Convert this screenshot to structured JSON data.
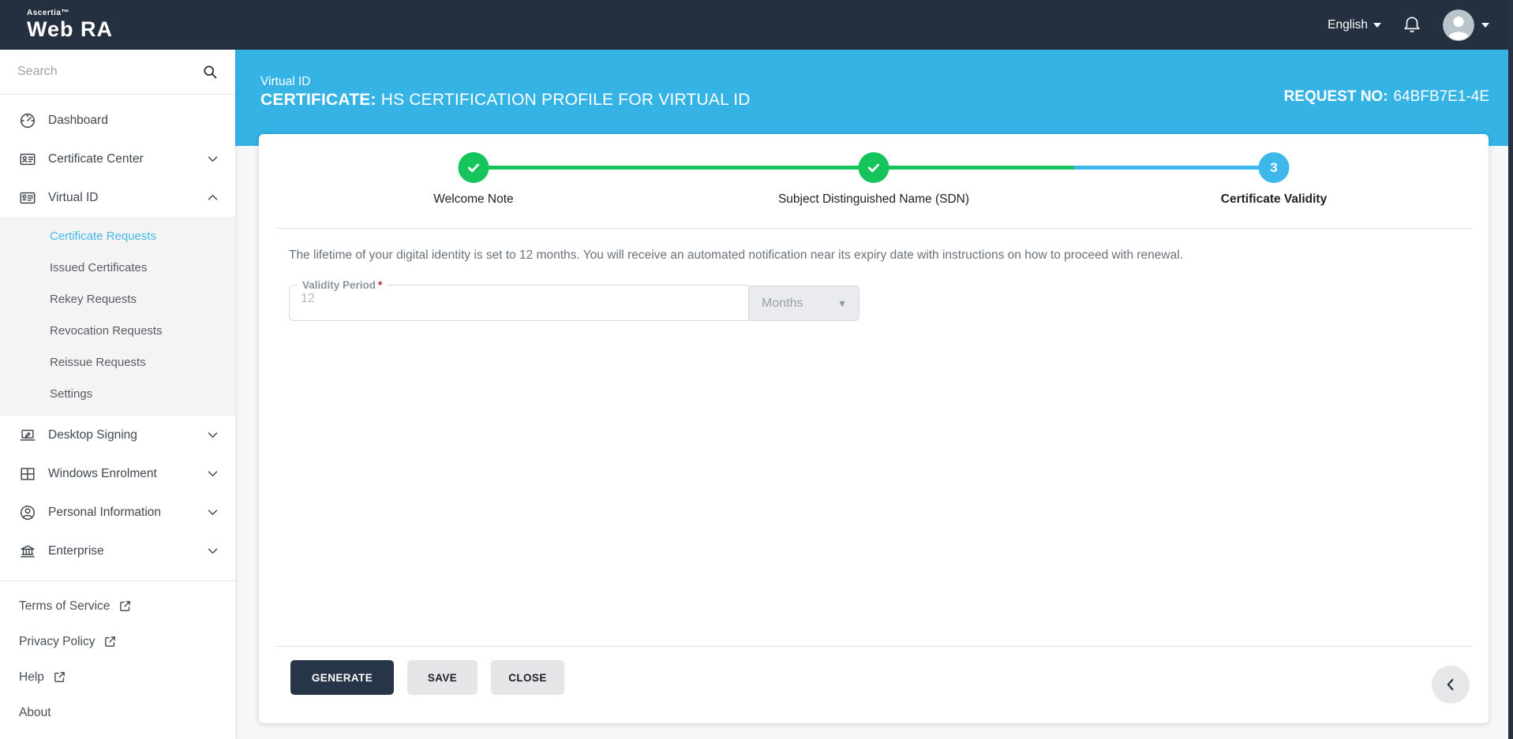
{
  "topbar": {
    "brand": {
      "company": "Ascertia™",
      "product_a": "Web",
      "product_b": "RA"
    },
    "language_label": "English"
  },
  "sidebar": {
    "search": {
      "placeholder": "Search"
    },
    "nav_upper": [
      {
        "label": "Dashboard"
      },
      {
        "label": "Certificate Center"
      },
      {
        "label": "Virtual ID"
      }
    ],
    "virtual_id_submenu": {
      "active": "Certificate Requests",
      "items": [
        "Certificate Requests",
        "Issued Certificates",
        "Rekey Requests",
        "Revocation Requests",
        "Reissue Requests",
        "Settings"
      ]
    },
    "nav_lower": [
      {
        "label": "Desktop Signing"
      },
      {
        "label": "Windows Enrolment"
      },
      {
        "label": "Personal Information"
      },
      {
        "label": "Enterprise"
      }
    ],
    "footer_links": [
      {
        "label": "Terms of Service",
        "external": true
      },
      {
        "label": "Privacy Policy",
        "external": true
      },
      {
        "label": "Help",
        "external": true
      },
      {
        "label": "About",
        "external": false
      }
    ]
  },
  "page_header": {
    "breadcrumb": "Virtual ID",
    "title_bold": "CERTIFICATE:",
    "title_rest": " HS CERTIFICATION PROFILE FOR VIRTUAL ID",
    "request_label": "REQUEST NO:",
    "request_value": "64BFB7E1-4E"
  },
  "stepper": {
    "steps": [
      {
        "label": "Welcome Note",
        "state": "complete"
      },
      {
        "label": "Subject Distinguished Name (SDN)",
        "state": "complete"
      },
      {
        "label": "Certificate Validity",
        "state": "active",
        "number": "3"
      }
    ]
  },
  "content": {
    "info_text": "The lifetime of your digital identity is set to 12 months. You will receive an automated notification near its expiry date with instructions on how to proceed with renewal.",
    "validity_field": {
      "label": "Validity Period",
      "required_mark": "*",
      "value": "12"
    },
    "unit_select": {
      "value": "Months"
    }
  },
  "actions": {
    "generate": "GENERATE",
    "save": "SAVE",
    "close": "CLOSE"
  },
  "colors": {
    "accent_blue": "#34b3e4",
    "success_green": "#16c45c",
    "dark_navy": "#242f40",
    "active_link": "#45b8e8"
  }
}
